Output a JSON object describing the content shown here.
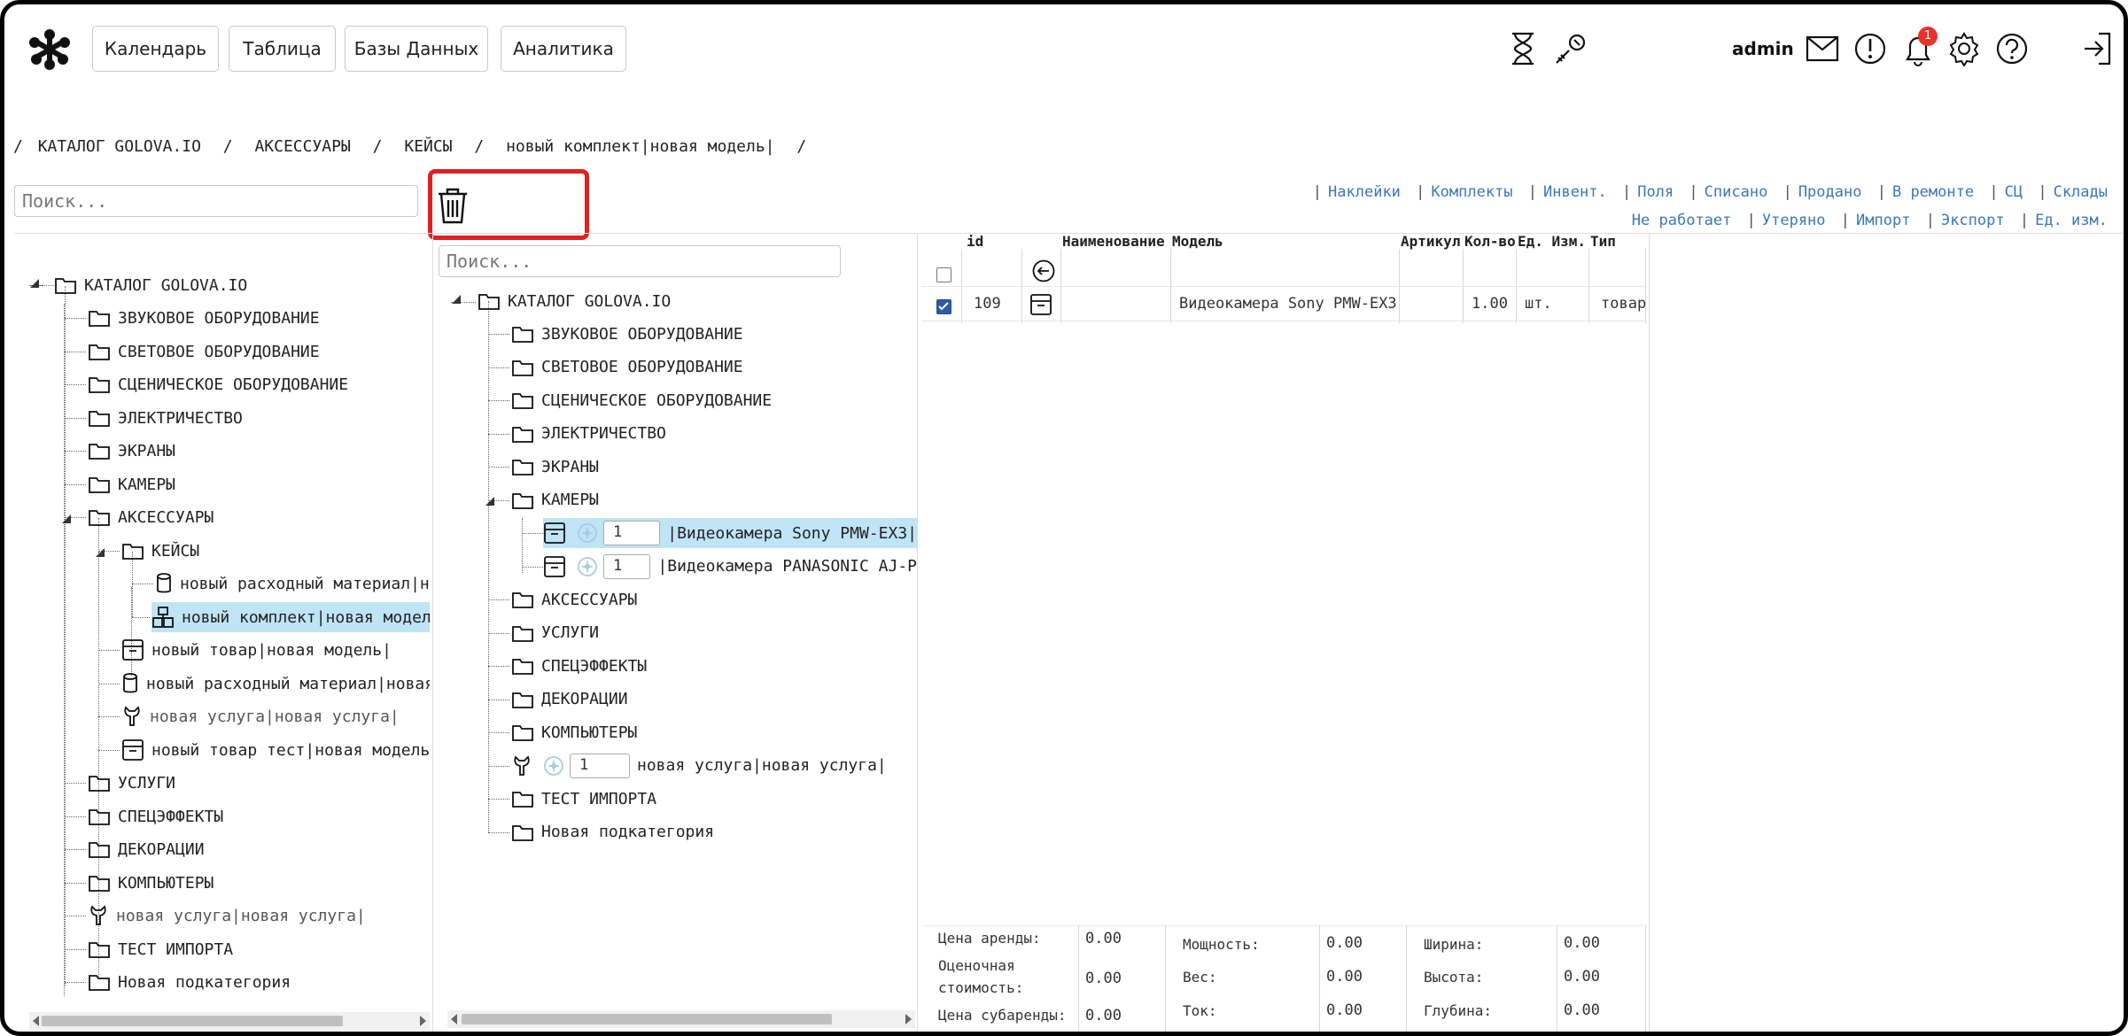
{
  "nav": {
    "buttons": [
      "Календарь",
      "Таблица",
      "Базы Данных",
      "Аналитика"
    ],
    "user": "admin",
    "notification_count": "1"
  },
  "breadcrumb": [
    "/",
    "КАТАЛОГ GOLOVA.IO",
    "/",
    "АКСЕССУАРЫ",
    "/",
    "КЕЙСЫ",
    "/",
    "новый комплект|новая модель|",
    "/"
  ],
  "search": {
    "left_placeholder": "Поиск...",
    "middle_placeholder": "Поиск..."
  },
  "links_row1": [
    "Наклейки",
    "Комплекты",
    "Инвент.",
    "Поля",
    "Списано",
    "Продано",
    "В ремонте",
    "СЦ",
    "Склады"
  ],
  "links_row2": [
    "Не работает",
    "Утеряно",
    "Импорт",
    "Экспорт",
    "Ед. изм."
  ],
  "left_tree": [
    "КАТАЛОГ GOLOVA.IO",
    "ЗВУКОВОЕ ОБОРУДОВАНИЕ",
    "СВЕТОВОЕ ОБОРУДОВАНИЕ",
    "СЦЕНИЧЕСКОЕ ОБОРУДОВАНИЕ",
    "ЭЛЕКТРИЧЕСТВО",
    "ЭКРАНЫ",
    "КАМЕРЫ",
    "АКСЕССУАРЫ",
    "КЕЙСЫ",
    "новый расходный материал|нова",
    "новый комплект|новая модель|",
    "новый товар|новая модель|",
    "новый расходный материал|новая м",
    "новая услуга|новая услуга|",
    "новый товар тест|новая модель те",
    "УСЛУГИ",
    "СПЕЦЭФФЕКТЫ",
    "ДЕКОРАЦИИ",
    "КОМПЬЮТЕРЫ",
    "новая услуга|новая услуга|",
    "ТЕСТ ИМПОРТА",
    "Новая подкатегория"
  ],
  "middle_tree": {
    "root": "КАТАЛОГ GOLOVA.IO",
    "items": [
      "ЗВУКОВОЕ ОБОРУДОВАНИЕ",
      "СВЕТОВОЕ ОБОРУДОВАНИЕ",
      "СЦЕНИЧЕСКОЕ ОБОРУДОВАНИЕ",
      "ЭЛЕКТРИЧЕСТВО",
      "ЭКРАНЫ",
      "КАМЕРЫ"
    ],
    "camera_items": [
      {
        "qty": "1",
        "label": "|Видеокамера Sony PMW-EX3|"
      },
      {
        "qty": "1",
        "label": "|Видеокамера PANASONIC AJ-P"
      }
    ],
    "items_after": [
      "АКСЕССУАРЫ",
      "УСЛУГИ",
      "СПЕЦЭФФЕКТЫ",
      "ДЕКОРАЦИИ",
      "КОМПЬЮТЕРЫ"
    ],
    "service_item": {
      "qty": "1",
      "label": "новая услуга|новая услуга|"
    },
    "items_end": [
      "ТЕСТ ИМПОРТА",
      "Новая подкатегория"
    ]
  },
  "table": {
    "headers": [
      "id",
      "Наименование",
      "Модель",
      "Артикул",
      "Кол-во",
      "Ед. Изм.",
      "Тип"
    ],
    "row": {
      "id": "109",
      "name": "",
      "model": "Видеокамера Sony PMW-EX3",
      "article": "",
      "qty": "1.00",
      "unit": "шт.",
      "type": "товар",
      "checked": true
    }
  },
  "fields": {
    "rent_price_label": "Цена аренды:",
    "rent_price": "0.00",
    "est_cost_label_1": "Оценочная",
    "est_cost_label_2": "стоимость:",
    "est_cost": "0.00",
    "subrent_label": "Цена субаренды:",
    "subrent": "0.00",
    "power_label": "Мощность:",
    "power": "0.00",
    "weight_label": "Вес:",
    "weight": "0.00",
    "current_label": "Ток:",
    "current": "0.00",
    "width_label": "Ширина:",
    "width": "0.00",
    "height_label": "Высота:",
    "height": "0.00",
    "depth_label": "Глубина:",
    "depth": "0.00"
  },
  "colors": {
    "link": "#3d78b8",
    "selected_bg": "#bfe4f5",
    "highlight_border": "#e02020",
    "badge": "#e8332a"
  }
}
